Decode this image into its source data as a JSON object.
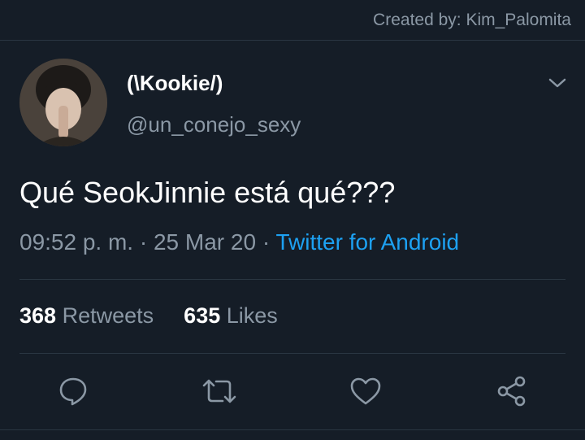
{
  "watermark": "Created by: Kim_Palomita",
  "user": {
    "display_name": "(\\Kookie/)",
    "handle": "@un_conejo_sexy"
  },
  "tweet": {
    "text": "Qué SeokJinnie está qué???",
    "time": "09:52 p. m.",
    "separator": "·",
    "date": "25 Mar 20",
    "source": "Twitter for Android"
  },
  "stats": {
    "retweets_count": "368",
    "retweets_label": "Retweets",
    "likes_count": "635",
    "likes_label": "Likes"
  },
  "icons": {
    "reply": "reply-icon",
    "retweet": "retweet-icon",
    "like": "heart-icon",
    "share": "share-icon",
    "more": "chevron-down-icon"
  },
  "colors": {
    "background": "#151d27",
    "secondary_text": "#8b98a5",
    "link": "#1da1f2"
  }
}
